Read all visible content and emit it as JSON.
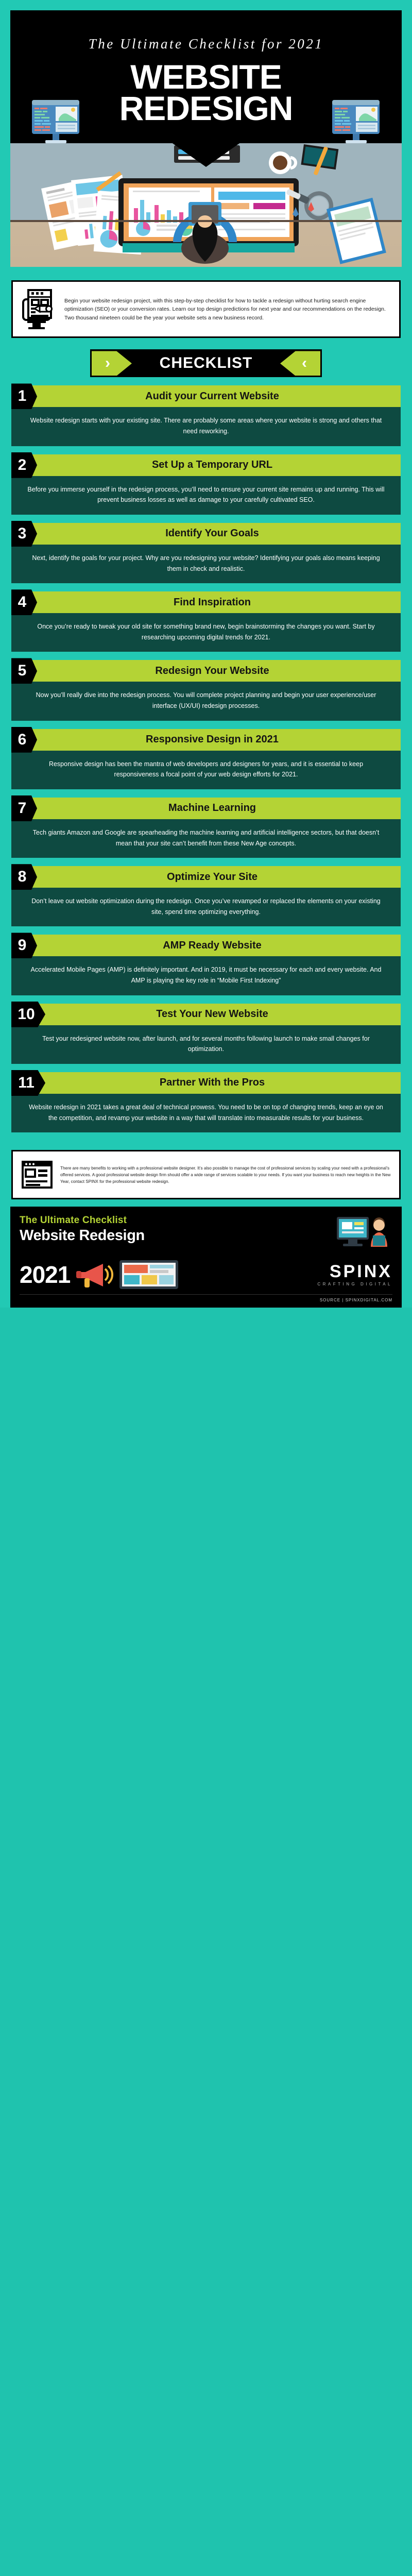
{
  "header": {
    "subtitle": "The Ultimate Checklist for 2021",
    "title_line1": "WEBSITE",
    "title_line2": "REDESIGN",
    "monitor_left_icon": "monitor-code-icon",
    "monitor_right_icon": "monitor-code-icon"
  },
  "intro": {
    "icon": "document-edit-monitor-icon",
    "text": "Begin your website redesign project, with this step-by-step checklist for how to tackle a redesign without hurting search engine optimization (SEO) or your conversion rates. Learn our top design predictions for next year and our recommendations on the redesign. Two thousand nineteen could be the year your website sets a new business record."
  },
  "checklist_banner": {
    "label": "CHECKLIST",
    "left_icon": "chevron-right-icon",
    "right_icon": "chevron-left-icon",
    "left_glyph": "›",
    "right_glyph": "‹"
  },
  "steps": [
    {
      "number": "1",
      "title": "Audit your Current Website",
      "body": "Website redesign starts with your existing site. There are probably some areas where your website is strong and others that need reworking."
    },
    {
      "number": "2",
      "title": "Set Up a Temporary URL",
      "body": "Before you immerse yourself in the redesign process, you’ll need to ensure your current site remains up and running. This will prevent business losses as well as damage to your carefully cultivated SEO."
    },
    {
      "number": "3",
      "title": "Identify Your Goals",
      "body": "Next, identify the goals for your project. Why are you redesigning your website? Identifying your goals also means keeping them in check and realistic."
    },
    {
      "number": "4",
      "title": "Find Inspiration",
      "body": "Once you’re ready to tweak your old site for something brand new, begin brainstorming the changes you want. Start by researching upcoming digital trends for 2021."
    },
    {
      "number": "5",
      "title": "Redesign Your Website",
      "body": "Now you’ll really dive into the redesign process. You will complete project planning and begin your user experience/user interface (UX/UI) redesign processes."
    },
    {
      "number": "6",
      "title": "Responsive Design in 2021",
      "body": "Responsive design has been the mantra of web developers and designers for years, and it is essential to keep responsiveness a focal point of your web design efforts for 2021."
    },
    {
      "number": "7",
      "title": "Machine Learning",
      "body": "Tech giants Amazon and Google are spearheading the machine learning and artificial intelligence sectors, but that doesn’t mean that your site can’t benefit from these New Age concepts."
    },
    {
      "number": "8",
      "title": "Optimize Your Site",
      "body": "Don’t leave out website optimization during the redesign. Once you’ve revamped or replaced the elements on your existing site, spend time optimizing everything."
    },
    {
      "number": "9",
      "title": "AMP Ready Website",
      "body": "Accelerated Mobile Pages (AMP) is definitely important. And in 2019, it must be necessary for each and every website. And AMP is playing the key role in “Mobile First Indexing”"
    },
    {
      "number": "10",
      "title": "Test Your New Website",
      "body": "Test your redesigned website now, after launch, and for several months following launch to make small changes for optimization."
    },
    {
      "number": "11",
      "title": "Partner With the Pros",
      "body": "Website redesign in 2021 takes a great deal of technical prowess. You need to be on top of changing trends, keep an eye on the competition, and revamp your website in a way that will translate into measurable results for your business."
    }
  ],
  "outro": {
    "icon": "browser-window-icon",
    "text": "There are many benefits to working with a professional website designer. It’s also possible to manage the cost of professional services by scaling your need with a professional’s offered services. A good professional website design firm should offer a wide range of services scalable to your needs. If you want your business to reach new heights in the New Year, contact SPINX for the professional website redesign."
  },
  "footer": {
    "line1": "The Ultimate Checklist",
    "line2": "Website Redesign",
    "year": "2021",
    "brand_name": "SPINX",
    "brand_tagline": "CRAFTING DIGITAL",
    "source": "SOURCE | SPINXDIGITAL.COM",
    "megaphone_icon": "megaphone-icon",
    "designer_icon": "designer-person-icon",
    "tablet_icon": "tablet-dashboard-icon"
  },
  "colors": {
    "teal": "#22c9b4",
    "lime": "#b4d335",
    "dark_green": "#0e4a41",
    "black": "#000000",
    "white": "#ffffff"
  }
}
